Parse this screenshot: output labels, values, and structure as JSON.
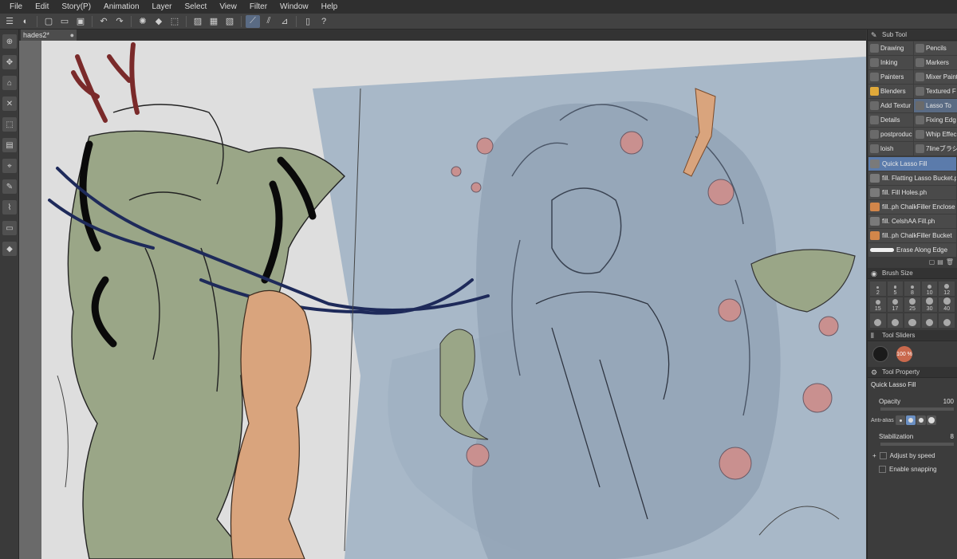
{
  "menu": [
    "File",
    "Edit",
    "Story(P)",
    "Animation",
    "Layer",
    "Select",
    "View",
    "Filter",
    "Window",
    "Help"
  ],
  "toolbar": {
    "icons": [
      "menu-icon",
      "quick-access-icon",
      "new-file-icon",
      "open-file-icon",
      "save-icon",
      "undo-icon",
      "redo-icon",
      "loading-icon",
      "fill-icon",
      "transform-icon",
      "clear-icon",
      "hide-selection-icon",
      "crop-icon",
      "snap-ruler-icon",
      "snap-special-ruler-icon",
      "snap-grid-icon",
      "device-icon",
      "help-icon"
    ]
  },
  "document": {
    "tab_title": "hades2*"
  },
  "colors": {
    "canvas_bg": "#dedede",
    "blue_bg": "#a8b8c8",
    "green_fill": "#9aa687",
    "skin_fill": "#d9a47d",
    "antler": "#7a2a2a",
    "navy_line": "#1e2a5a",
    "accent": "#5b7bab"
  },
  "panels": {
    "subtool": {
      "title": "Sub Tool",
      "groups": [
        {
          "label": "Drawing",
          "icon": "pen-icon"
        },
        {
          "label": "Pencils",
          "icon": "pencil-icon"
        },
        {
          "label": "Inking",
          "icon": "ink-icon"
        },
        {
          "label": "Markers",
          "icon": "marker-icon"
        },
        {
          "label": "Painters",
          "icon": "brush-icon"
        },
        {
          "label": "Mixer Paint",
          "icon": "mixer-icon"
        },
        {
          "label": "Blenders",
          "icon": "blender-icon"
        },
        {
          "label": "Textured F",
          "icon": "texture-icon"
        },
        {
          "label": "Add Textur",
          "icon": "add-texture-icon"
        },
        {
          "label": "Lasso To",
          "icon": "lasso-icon"
        },
        {
          "label": "Details",
          "icon": "details-icon"
        },
        {
          "label": "Fixing Edg",
          "icon": "fixing-icon"
        },
        {
          "label": "postproduc",
          "icon": "post-icon"
        },
        {
          "label": "Whip Effec",
          "icon": "whip-icon"
        },
        {
          "label": "loish",
          "icon": "loish-icon"
        },
        {
          "label": "7lineブラシ",
          "icon": "line-brush-icon"
        }
      ],
      "tools": [
        "Quick Lasso Fill",
        "fill. Flatting Lasso Bucket.ph",
        "fill. Fill Holes.ph",
        "fill..ph ChalkFiller Enclose",
        "fill. CelshAA Fill.ph",
        "fill..ph ChalkFiller Bucket",
        "Erase Along Edge"
      ]
    },
    "brush_size": {
      "title": "Brush Size",
      "sizes": [
        "2",
        "5",
        "8",
        "10",
        "12",
        "15",
        "17",
        "25",
        "30",
        "40",
        "",
        "",
        "",
        "",
        ""
      ]
    },
    "tool_sliders": {
      "title": "Tool Sliders",
      "opacity_badge": "100 %"
    },
    "tool_property": {
      "title": "Tool Property",
      "tool_name": "Quick Lasso Fill",
      "opacity_label": "Opacity",
      "opacity_value": "100",
      "antialias_label": "Anti-alias",
      "stabilization_label": "Stabilization",
      "stabilization_value": "8",
      "adjust_speed_label": "Adjust by speed",
      "enable_snapping_label": "Enable snapping"
    }
  }
}
